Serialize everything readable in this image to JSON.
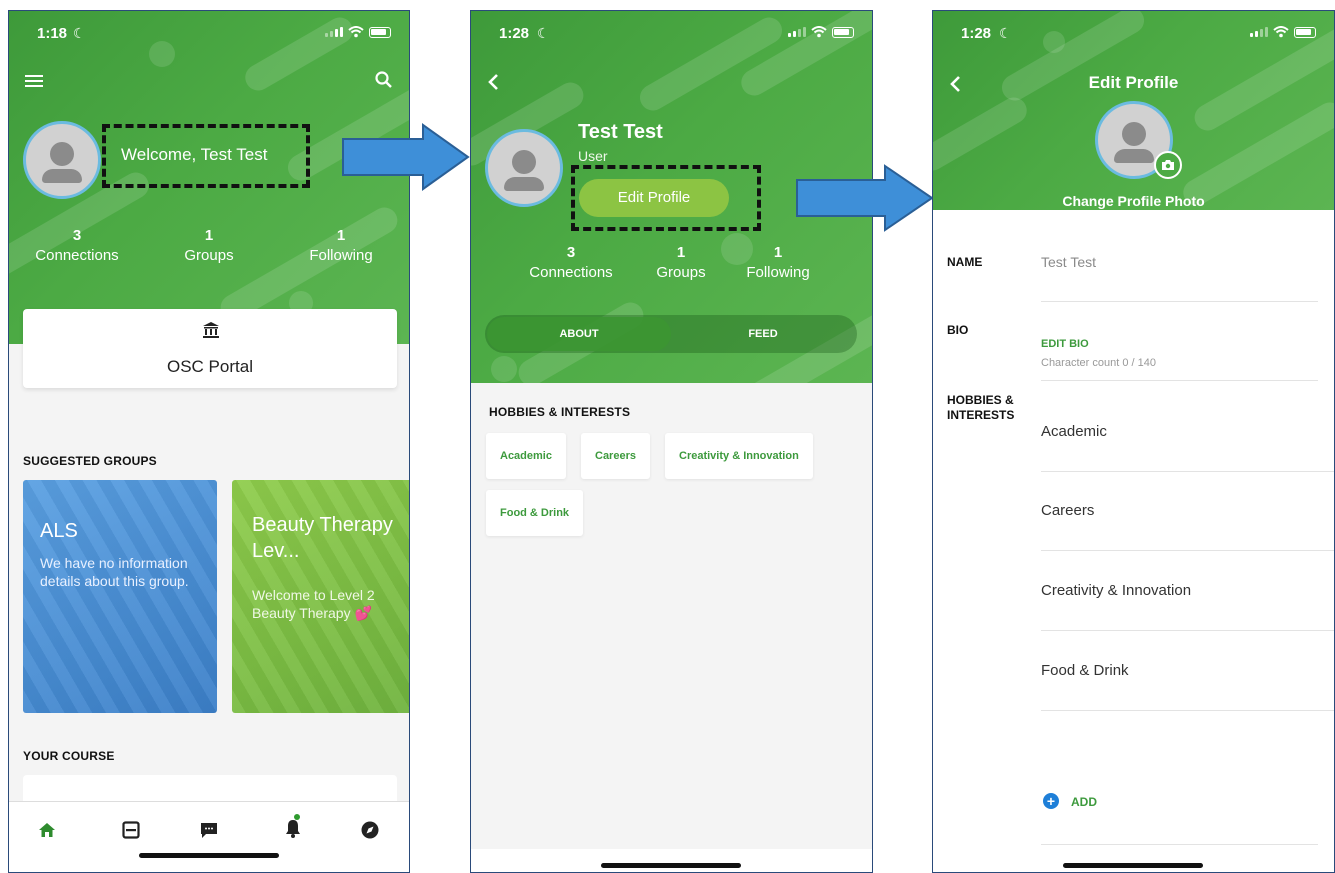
{
  "screen1": {
    "status_time": "1:18",
    "welcome_text": "Welcome, Test Test",
    "stats": [
      {
        "count": "3",
        "label": "Connections"
      },
      {
        "count": "1",
        "label": "Groups"
      },
      {
        "count": "1",
        "label": "Following"
      }
    ],
    "portal_label": "OSC Portal",
    "suggested_groups_title": "SUGGESTED GROUPS",
    "groups": [
      {
        "name": "ALS",
        "description": "We have no information details about this group."
      },
      {
        "name": "Beauty Therapy Lev...",
        "description": "Welcome to Level 2 Beauty Therapy 💕"
      }
    ],
    "your_course_title": "YOUR COURSE",
    "nav_icons": [
      "home-icon",
      "feed-icon",
      "chat-icon",
      "bell-icon",
      "compass-icon"
    ]
  },
  "screen2": {
    "status_time": "1:28",
    "user_name": "Test Test",
    "user_role": "User",
    "edit_profile_label": "Edit Profile",
    "stats": [
      {
        "count": "3",
        "label": "Connections"
      },
      {
        "count": "1",
        "label": "Groups"
      },
      {
        "count": "1",
        "label": "Following"
      }
    ],
    "tabs": [
      {
        "label": "ABOUT"
      },
      {
        "label": "FEED"
      }
    ],
    "hobbies_title": "HOBBIES & INTERESTS",
    "hobbies": [
      "Academic",
      "Careers",
      "Creativity & Innovation",
      "Food & Drink"
    ]
  },
  "screen3": {
    "status_time": "1:28",
    "title": "Edit Profile",
    "change_photo_label": "Change Profile Photo",
    "name_label": "NAME",
    "name_value": "Test Test",
    "bio_label": "BIO",
    "edit_bio_label": "EDIT BIO",
    "char_count": "Character count 0 / 140",
    "hobbies_label_1": "HOBBIES &",
    "hobbies_label_2": "INTERESTS",
    "hobbies": [
      "Academic",
      "Careers",
      "Creativity & Innovation",
      "Food & Drink"
    ],
    "add_label": "ADD"
  },
  "colors": {
    "brand_green": "#4caa44",
    "button_green": "#8cc443",
    "accent_blue": "#1e7fd8",
    "arrow_blue": "#3e8fd8"
  }
}
